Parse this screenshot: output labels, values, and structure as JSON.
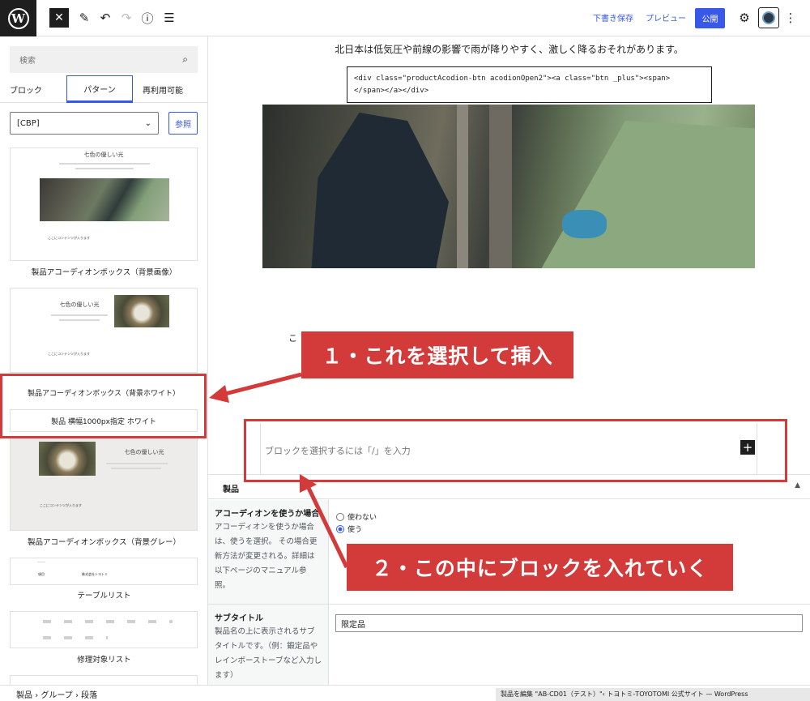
{
  "toolbar": {
    "save_draft": "下書き保存",
    "preview": "プレビュー",
    "publish": "公開"
  },
  "sidebar": {
    "search_placeholder": "検索",
    "tabs": [
      "ブロック",
      "パターン",
      "再利用可能"
    ],
    "category_select": "[CBP]",
    "browse_button": "参照",
    "patterns": [
      {
        "label": "製品アコーディオンボックス（背景画像）",
        "mini_title": "七色の優しい光",
        "mini_note": "ここにコンテンツが入ります"
      },
      {
        "label": "製品アコーディオンボックス（背景ホワイト）",
        "mini_title": "七色の優しい光",
        "mini_note": "ここにコンテンツが入ります"
      },
      {
        "label": "製品 横幅1000px指定 ホワイト"
      },
      {
        "label": "製品アコーディオンボックス（背景グレー）",
        "mini_title": "七色の優しい光",
        "mini_note": "ここにコンテンツが入ります"
      },
      {
        "label": "テーブルリスト",
        "mini_cells": [
          "項目",
          "株式会社トヨトミ"
        ]
      },
      {
        "label": "修理対象リスト"
      }
    ]
  },
  "editor": {
    "paragraph": "北日本は低気圧や前線の影響で雨が降りやすく、激しく降るおそれがあります。",
    "code_line1": "<div class=\"productAcodion-btn acodionOpen2\"><a class=\"btn _plus\"><span>",
    "code_line2": "</span></a></div>",
    "cut_text": "こ",
    "block_placeholder": "ブロックを選択するには「/」を入力"
  },
  "meta": {
    "panel_title": "製品",
    "accordion": {
      "title": "アコーディオンを使うか場合",
      "desc": "アコーディオンを使うか場合は、使うを選択。 その場合更新方法が変更される。詳細は以下ページのマニュアル参照。",
      "options": [
        "使わない",
        "使う"
      ],
      "selected": "使う"
    },
    "subtitle": {
      "title": "サブタイトル",
      "desc": "製品名の上に表示されるサブタイトルです。（例：鍛定品やレインボーストーブなど入力します）",
      "value": "限定品"
    }
  },
  "statusbar": {
    "breadcrumb": [
      "製品",
      "グループ",
      "段落"
    ],
    "window_title": "製品を編集 \"AB-CD01（テスト）\"‹ トヨトミ-TOYOTOMI 公式サイト — WordPress"
  },
  "annotations": {
    "callout1": "１・これを選択して挿入",
    "callout2": "２・この中にブロックを入れていく",
    "accent_color": "#d33b3b"
  },
  "colors": {
    "wp_blue": "#3858e9",
    "dark": "#1e1e1e"
  }
}
